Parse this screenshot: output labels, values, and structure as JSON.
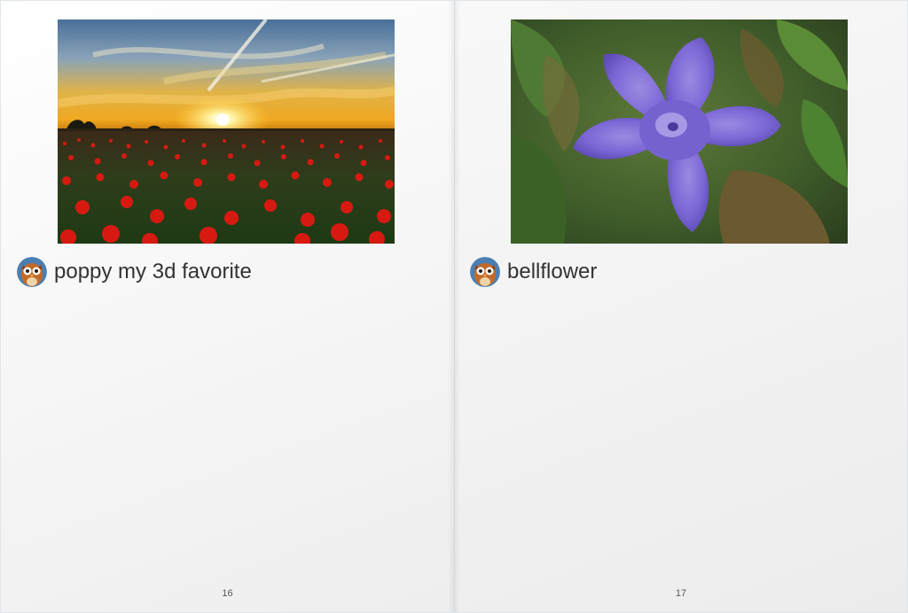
{
  "pages": [
    {
      "photo_subject": "poppy-field-sunset",
      "caption": "poppy my 3d favorite",
      "page_number": "16",
      "avatar_icon": "owl-avatar-icon"
    },
    {
      "photo_subject": "purple-bellflower",
      "caption": "bellflower",
      "page_number": "17",
      "avatar_icon": "owl-avatar-icon"
    }
  ],
  "colors": {
    "page_background": "#f5f5f5",
    "caption_text": "#333333",
    "page_number_text": "#555555",
    "frame": "#dfe6ec"
  }
}
